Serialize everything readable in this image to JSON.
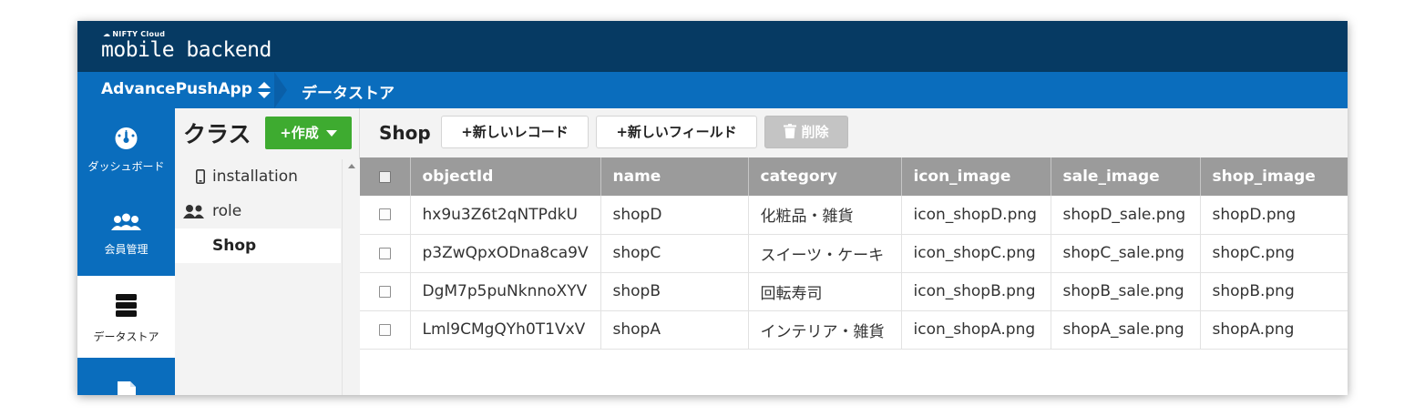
{
  "brand": {
    "small": "NIFTY Cloud",
    "main": "mobile backend"
  },
  "appbar": {
    "app_name": "AdvancePushApp",
    "current_section": "データストア"
  },
  "sidenav": {
    "items": [
      {
        "label": "ダッシュボード",
        "icon": "gauge-icon"
      },
      {
        "label": "会員管理",
        "icon": "users-icon"
      },
      {
        "label": "データストア",
        "icon": "database-icon",
        "active": true
      },
      {
        "label": "",
        "icon": "file-icon"
      }
    ]
  },
  "classes": {
    "title": "クラス",
    "create_label": "+作成",
    "items": [
      {
        "label": "installation",
        "icon": "phone-icon"
      },
      {
        "label": "role",
        "icon": "role-users-icon"
      },
      {
        "label": "Shop",
        "icon": "",
        "selected": true
      }
    ]
  },
  "toolbar": {
    "title": "Shop",
    "new_record_label": "+新しいレコード",
    "new_field_label": "+新しいフィールド",
    "delete_label": "削除"
  },
  "table": {
    "columns": [
      "objectId",
      "name",
      "category",
      "icon_image",
      "sale_image",
      "shop_image"
    ],
    "rows": [
      [
        "hx9u3Z6t2qNTPdkU",
        "shopD",
        "化粧品・雑貨",
        "icon_shopD.png",
        "shopD_sale.png",
        "shopD.png"
      ],
      [
        "p3ZwQpxODna8ca9V",
        "shopC",
        "スイーツ・ケーキ",
        "icon_shopC.png",
        "shopC_sale.png",
        "shopC.png"
      ],
      [
        "DgM7p5puNknnoXYV",
        "shopB",
        "回転寿司",
        "icon_shopB.png",
        "shopB_sale.png",
        "shopB.png"
      ],
      [
        "Lml9CMgQYh0T1VxV",
        "shopA",
        "インテリア・雑貨",
        "icon_shopA.png",
        "shopA_sale.png",
        "shopA.png"
      ]
    ]
  },
  "colors": {
    "topbar": "#063a63",
    "appbar": "#0a6dbd",
    "create_button": "#3eab30",
    "table_header": "#9b9b9b"
  }
}
